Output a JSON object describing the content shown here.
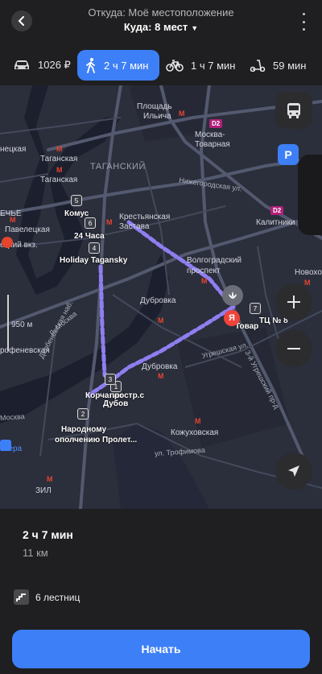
{
  "header": {
    "from": "Откуда: Моё местоположение",
    "to": "Куда: 8 мест"
  },
  "modes": [
    {
      "name": "car",
      "label": "1026 ₽"
    },
    {
      "name": "walk",
      "label": "2 ч 7 мин",
      "selected": true
    },
    {
      "name": "bike",
      "label": "1 ч 7 мин"
    },
    {
      "name": "scooter",
      "label": "59 мин"
    }
  ],
  "map": {
    "labels": {
      "ploshchad": "Площадь",
      "ilyicha": "Ильича",
      "moskva": "Москва-",
      "tovarnaya": "Товарная",
      "taganskaya1": "Таганская",
      "taganskaya2": "Таганская",
      "tagansky": "ТАГАНСКИЙ",
      "nizhegorodskaya": "Нижегородская ул.",
      "krest1": "Крестьянская",
      "krest2": "Застава",
      "kalitniki": "Калитники",
      "paveletskaya": "Павелецкая",
      "vokzal": "ецкий вкз.",
      "komus": "Комус",
      "chasa": "24 Часа",
      "holiday": "Holiday Tagansky",
      "volgograd1": "Волгоградский",
      "volgograd2": "проспект",
      "novokhokhl": "Новохох",
      "dubrovka1": "Дубровка",
      "dubrovka2": "Дубровка",
      "tts": "ТЦ № 8",
      "tovar2": "Товар",
      "dist950": "950 м",
      "dobryninskaya": "рофеневская",
      "ugreshskaya": "Угрешская ул.",
      "ugreshskiy": "3-й Угрешский пр-д",
      "korch": "Корчагин",
      "prospras": "простр.с",
      "dubovsk": "Дубов",
      "narodnomu": "Народному",
      "opolch": "ополчению Пролет...",
      "kozhukh": "Кожуховская",
      "trofimova": "ул. Трофимова",
      "zil": "ЗИЛ",
      "moskvaRiver": "Москва",
      "verva": "ьвера",
      "derb": "Дербеневская наб.",
      "rMoskva": "р. Москва",
      "nechye": "ЕЧЬЕ",
      "netskaya": "нецкая",
      "d2a": "D2",
      "d2b": "D2",
      "parking": "P"
    },
    "stops": [
      "1",
      "2",
      "3",
      "4",
      "5",
      "6",
      "7"
    ]
  },
  "route": {
    "duration": "2 ч 7 мин",
    "distance": "11 км",
    "stairs": "6 лестниц"
  },
  "start_button": "Начать",
  "colors": {
    "accent": "#3d7ff6",
    "route": "#8f7ef0",
    "background": "#1f1f21",
    "map": "#2b2e3b",
    "metro": "#e3452f"
  }
}
